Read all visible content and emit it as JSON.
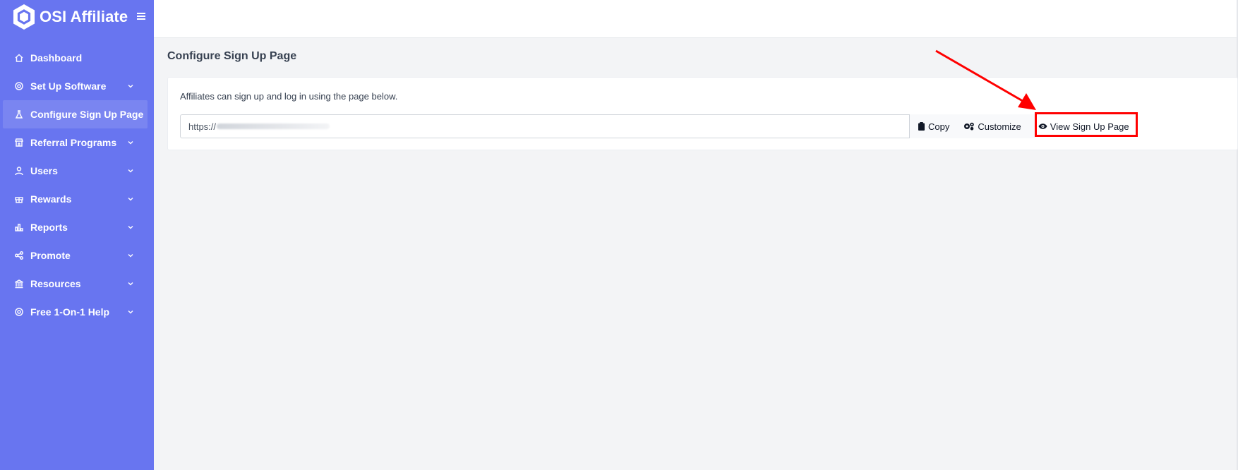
{
  "brand": {
    "name": "OSI Affiliate",
    "menu_icon": "☰"
  },
  "sidebar": {
    "items": [
      {
        "label": "Dashboard",
        "icon": "home-icon",
        "has_chevron": false,
        "active": false
      },
      {
        "label": "Set Up Software",
        "icon": "gear-icon",
        "has_chevron": true,
        "active": false
      },
      {
        "label": "Configure Sign Up Page",
        "icon": "flask-icon",
        "has_chevron": false,
        "active": true
      },
      {
        "label": "Referral Programs",
        "icon": "store-icon",
        "has_chevron": true,
        "active": false
      },
      {
        "label": "Users",
        "icon": "user-icon",
        "has_chevron": true,
        "active": false
      },
      {
        "label": "Rewards",
        "icon": "gift-icon",
        "has_chevron": true,
        "active": false
      },
      {
        "label": "Reports",
        "icon": "chart-icon",
        "has_chevron": true,
        "active": false
      },
      {
        "label": "Promote",
        "icon": "share-icon",
        "has_chevron": true,
        "active": false
      },
      {
        "label": "Resources",
        "icon": "bank-icon",
        "has_chevron": true,
        "active": false
      },
      {
        "label": "Free 1-On-1 Help",
        "icon": "lifebuoy-icon",
        "has_chevron": true,
        "active": false
      }
    ]
  },
  "main": {
    "title": "Configure Sign Up Page",
    "card": {
      "description": "Affiliates can sign up and log in using the page below.",
      "url_prefix": "https://",
      "buttons": {
        "copy": "Copy",
        "customize": "Customize",
        "view": "View Sign Up Page"
      }
    }
  },
  "colors": {
    "sidebar_bg": "#6875f0",
    "highlight": "#ff0000",
    "page_bg": "#f3f4f6"
  }
}
